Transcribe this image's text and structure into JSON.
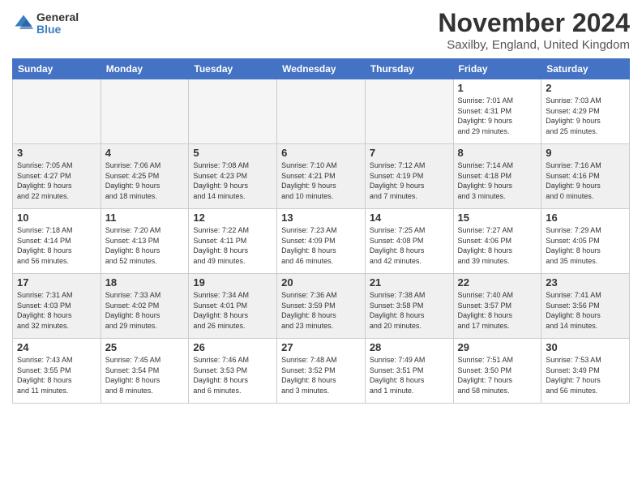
{
  "logo": {
    "general": "General",
    "blue": "Blue"
  },
  "header": {
    "month": "November 2024",
    "location": "Saxilby, England, United Kingdom"
  },
  "weekdays": [
    "Sunday",
    "Monday",
    "Tuesday",
    "Wednesday",
    "Thursday",
    "Friday",
    "Saturday"
  ],
  "weeks": [
    [
      {
        "day": "",
        "info": ""
      },
      {
        "day": "",
        "info": ""
      },
      {
        "day": "",
        "info": ""
      },
      {
        "day": "",
        "info": ""
      },
      {
        "day": "",
        "info": ""
      },
      {
        "day": "1",
        "info": "Sunrise: 7:01 AM\nSunset: 4:31 PM\nDaylight: 9 hours\nand 29 minutes."
      },
      {
        "day": "2",
        "info": "Sunrise: 7:03 AM\nSunset: 4:29 PM\nDaylight: 9 hours\nand 25 minutes."
      }
    ],
    [
      {
        "day": "3",
        "info": "Sunrise: 7:05 AM\nSunset: 4:27 PM\nDaylight: 9 hours\nand 22 minutes."
      },
      {
        "day": "4",
        "info": "Sunrise: 7:06 AM\nSunset: 4:25 PM\nDaylight: 9 hours\nand 18 minutes."
      },
      {
        "day": "5",
        "info": "Sunrise: 7:08 AM\nSunset: 4:23 PM\nDaylight: 9 hours\nand 14 minutes."
      },
      {
        "day": "6",
        "info": "Sunrise: 7:10 AM\nSunset: 4:21 PM\nDaylight: 9 hours\nand 10 minutes."
      },
      {
        "day": "7",
        "info": "Sunrise: 7:12 AM\nSunset: 4:19 PM\nDaylight: 9 hours\nand 7 minutes."
      },
      {
        "day": "8",
        "info": "Sunrise: 7:14 AM\nSunset: 4:18 PM\nDaylight: 9 hours\nand 3 minutes."
      },
      {
        "day": "9",
        "info": "Sunrise: 7:16 AM\nSunset: 4:16 PM\nDaylight: 9 hours\nand 0 minutes."
      }
    ],
    [
      {
        "day": "10",
        "info": "Sunrise: 7:18 AM\nSunset: 4:14 PM\nDaylight: 8 hours\nand 56 minutes."
      },
      {
        "day": "11",
        "info": "Sunrise: 7:20 AM\nSunset: 4:13 PM\nDaylight: 8 hours\nand 52 minutes."
      },
      {
        "day": "12",
        "info": "Sunrise: 7:22 AM\nSunset: 4:11 PM\nDaylight: 8 hours\nand 49 minutes."
      },
      {
        "day": "13",
        "info": "Sunrise: 7:23 AM\nSunset: 4:09 PM\nDaylight: 8 hours\nand 46 minutes."
      },
      {
        "day": "14",
        "info": "Sunrise: 7:25 AM\nSunset: 4:08 PM\nDaylight: 8 hours\nand 42 minutes."
      },
      {
        "day": "15",
        "info": "Sunrise: 7:27 AM\nSunset: 4:06 PM\nDaylight: 8 hours\nand 39 minutes."
      },
      {
        "day": "16",
        "info": "Sunrise: 7:29 AM\nSunset: 4:05 PM\nDaylight: 8 hours\nand 35 minutes."
      }
    ],
    [
      {
        "day": "17",
        "info": "Sunrise: 7:31 AM\nSunset: 4:03 PM\nDaylight: 8 hours\nand 32 minutes."
      },
      {
        "day": "18",
        "info": "Sunrise: 7:33 AM\nSunset: 4:02 PM\nDaylight: 8 hours\nand 29 minutes."
      },
      {
        "day": "19",
        "info": "Sunrise: 7:34 AM\nSunset: 4:01 PM\nDaylight: 8 hours\nand 26 minutes."
      },
      {
        "day": "20",
        "info": "Sunrise: 7:36 AM\nSunset: 3:59 PM\nDaylight: 8 hours\nand 23 minutes."
      },
      {
        "day": "21",
        "info": "Sunrise: 7:38 AM\nSunset: 3:58 PM\nDaylight: 8 hours\nand 20 minutes."
      },
      {
        "day": "22",
        "info": "Sunrise: 7:40 AM\nSunset: 3:57 PM\nDaylight: 8 hours\nand 17 minutes."
      },
      {
        "day": "23",
        "info": "Sunrise: 7:41 AM\nSunset: 3:56 PM\nDaylight: 8 hours\nand 14 minutes."
      }
    ],
    [
      {
        "day": "24",
        "info": "Sunrise: 7:43 AM\nSunset: 3:55 PM\nDaylight: 8 hours\nand 11 minutes."
      },
      {
        "day": "25",
        "info": "Sunrise: 7:45 AM\nSunset: 3:54 PM\nDaylight: 8 hours\nand 8 minutes."
      },
      {
        "day": "26",
        "info": "Sunrise: 7:46 AM\nSunset: 3:53 PM\nDaylight: 8 hours\nand 6 minutes."
      },
      {
        "day": "27",
        "info": "Sunrise: 7:48 AM\nSunset: 3:52 PM\nDaylight: 8 hours\nand 3 minutes."
      },
      {
        "day": "28",
        "info": "Sunrise: 7:49 AM\nSunset: 3:51 PM\nDaylight: 8 hours\nand 1 minute."
      },
      {
        "day": "29",
        "info": "Sunrise: 7:51 AM\nSunset: 3:50 PM\nDaylight: 7 hours\nand 58 minutes."
      },
      {
        "day": "30",
        "info": "Sunrise: 7:53 AM\nSunset: 3:49 PM\nDaylight: 7 hours\nand 56 minutes."
      }
    ]
  ]
}
